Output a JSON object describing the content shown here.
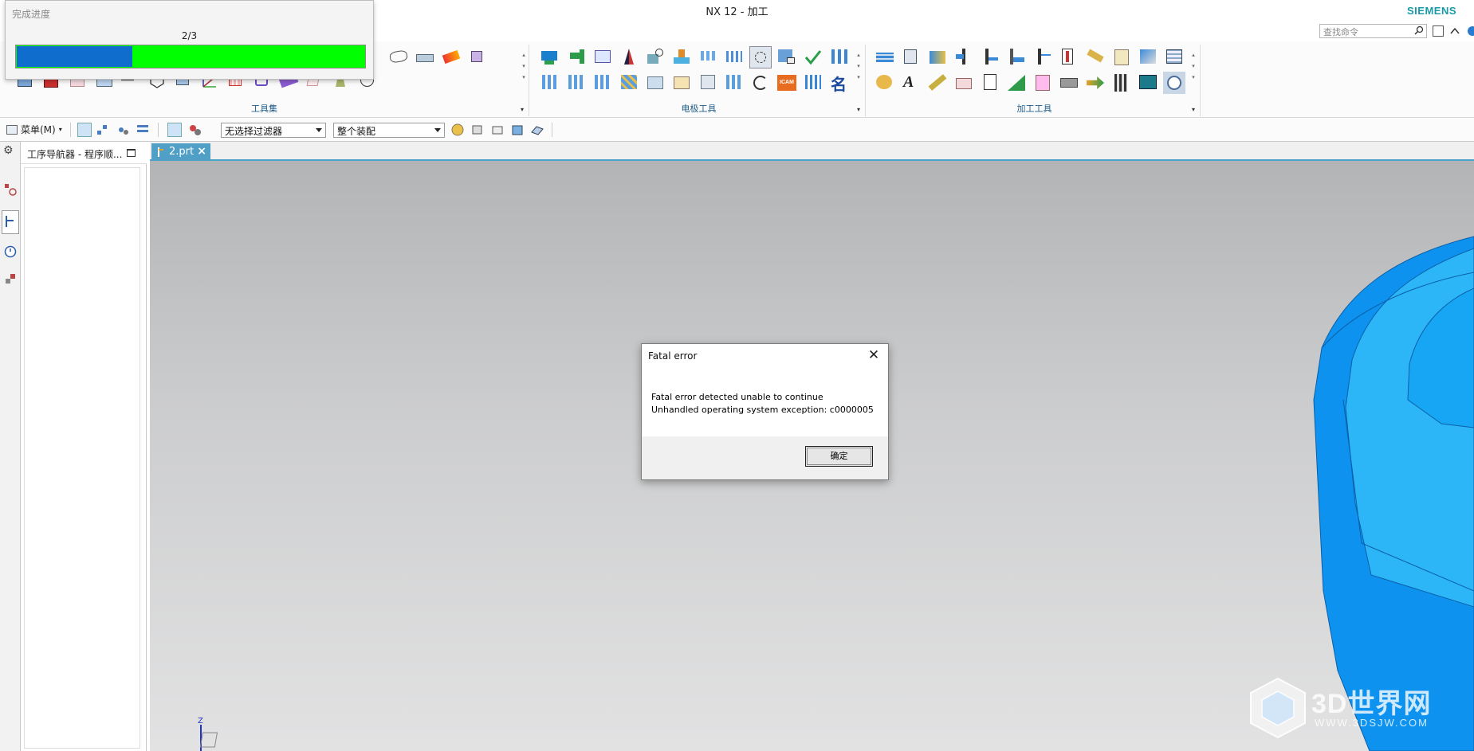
{
  "window": {
    "title": "NX 12 - 加工",
    "brand": "SIEMENS"
  },
  "ribbon": {
    "search_placeholder": "查找命令",
    "groups": [
      {
        "label": "工具集"
      },
      {
        "label": "电极工具"
      },
      {
        "label": "加工工具"
      }
    ]
  },
  "toolbar": {
    "menu_label": "菜单(M)",
    "selection_filter": "无选择过滤器",
    "assembly_scope": "整个装配"
  },
  "navigator": {
    "title": "工序导航器 - 程序顺..."
  },
  "file_tab": {
    "label": "2.prt"
  },
  "progress_dialog": {
    "title": "完成进度",
    "count": "2/3",
    "fraction": 0.33
  },
  "fatal_dialog": {
    "title": "Fatal error",
    "line1": "Fatal error detected unable to continue",
    "line2": "Unhandled operating system exception: c0000005",
    "ok_label": "确定"
  },
  "colors": {
    "progress_fill": "#0f6ecd",
    "progress_track": "#00ff00",
    "model_blue": "#1ea4f0",
    "tab_blue": "#4f9fc6"
  },
  "watermark": {
    "text": "3D世界网",
    "sub": "WWW.3DSJW.COM"
  }
}
